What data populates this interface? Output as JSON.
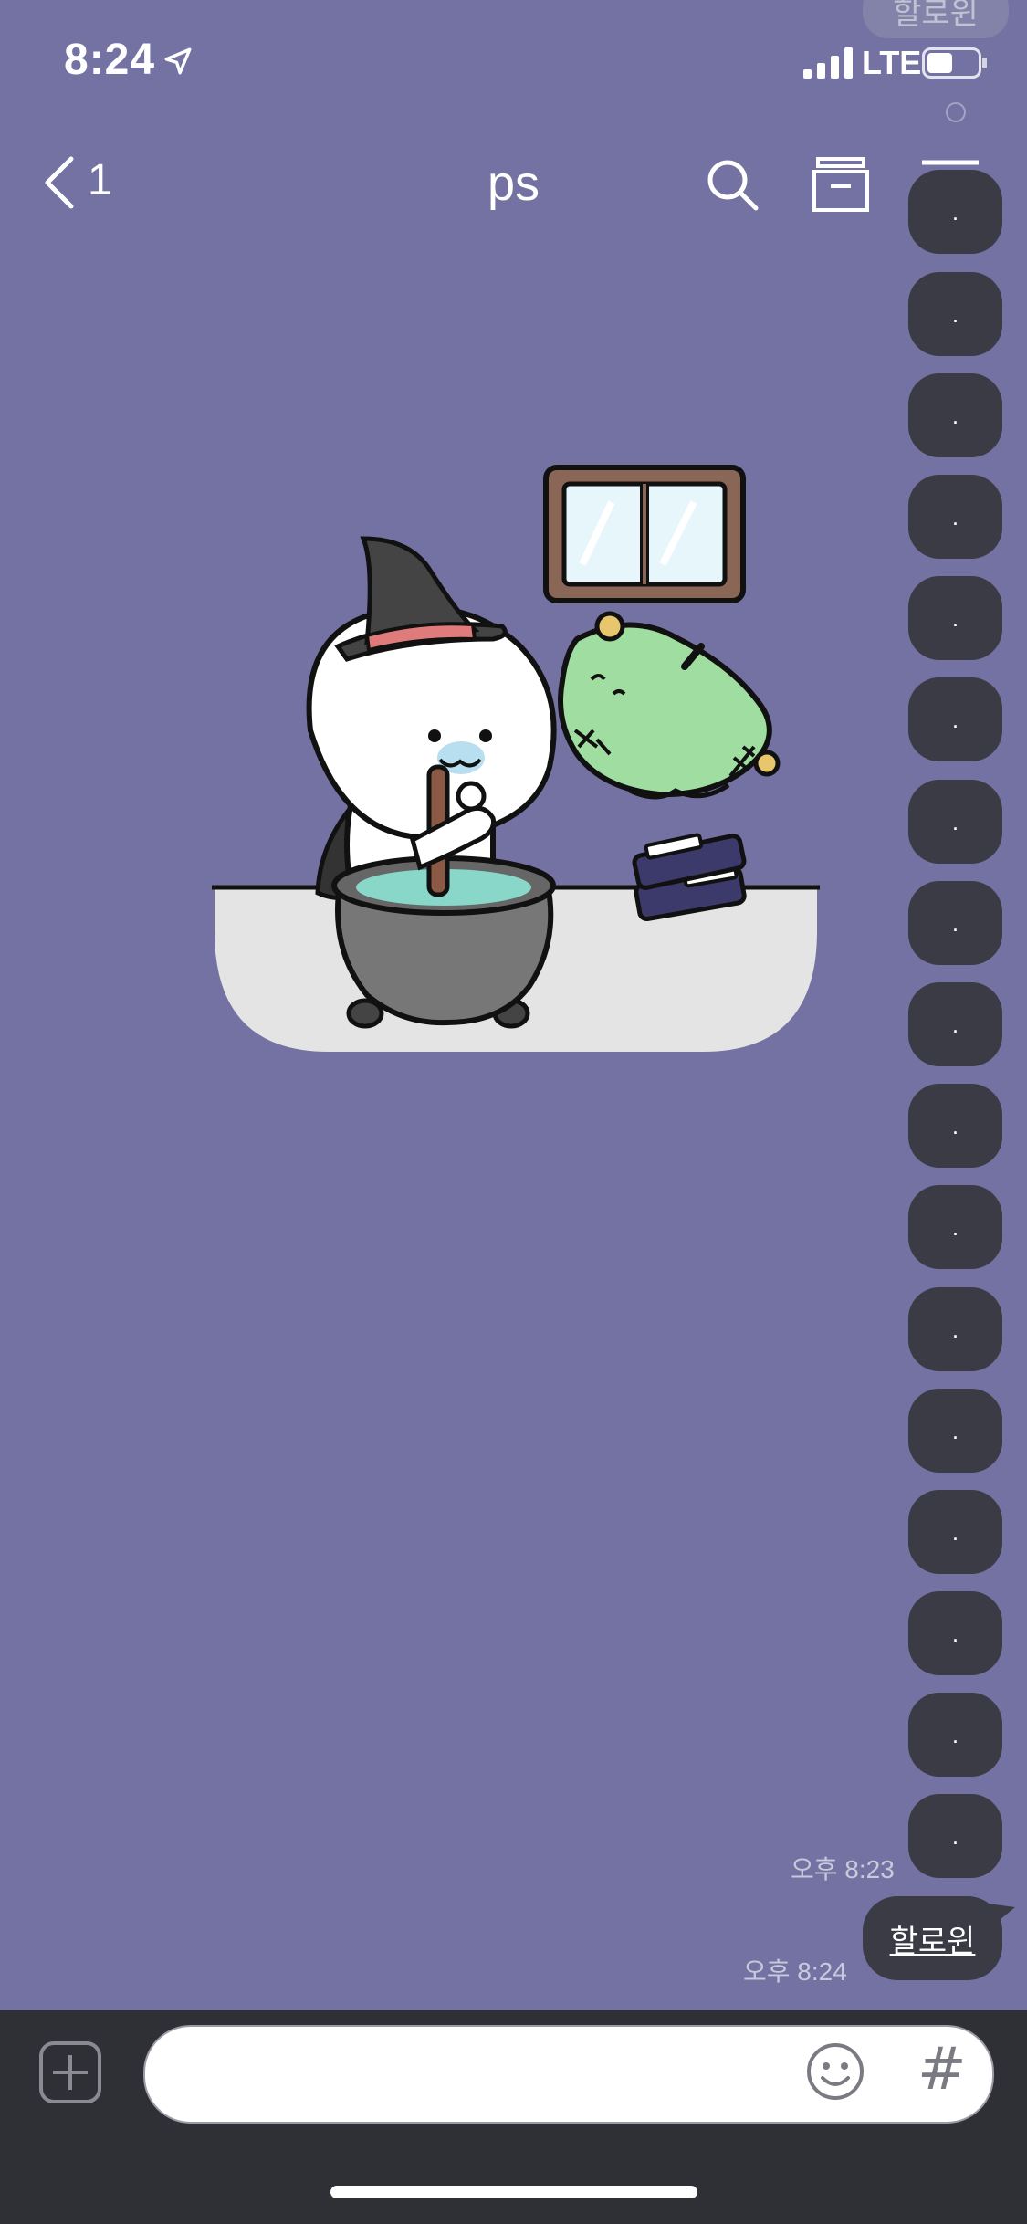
{
  "status_bar": {
    "time": "8:24",
    "network": "LTE",
    "battery_percent": 50
  },
  "nav": {
    "back_count": "1",
    "title": "ps"
  },
  "sticker": {
    "description_icon": "halloween-witch-cauldron-sticker"
  },
  "messages": {
    "top_partial": "할로윈",
    "dot_bubbles": [
      ".",
      ".",
      ".",
      ".",
      ".",
      ".",
      ".",
      ".",
      ".",
      ".",
      ".",
      ".",
      ".",
      ".",
      ".",
      ".",
      "."
    ],
    "timestamp_1": "오후 8:23",
    "last_message": "할로윈",
    "timestamp_2": "오후 8:24"
  },
  "input_bar": {
    "hash_label": "#",
    "placeholder": ""
  },
  "colors": {
    "background": "#7472a3",
    "bubble": "#3a3b45",
    "input_bar": "#2f3036"
  }
}
